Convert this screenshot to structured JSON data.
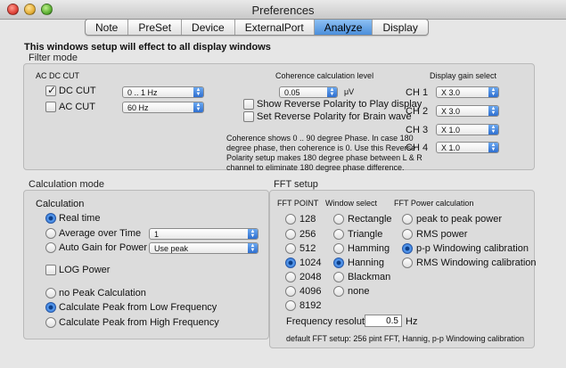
{
  "window": {
    "title": "Preferences"
  },
  "tabs": [
    "Note",
    "PreSet",
    "Device",
    "ExternalPort",
    "Analyze",
    "Display"
  ],
  "active_tab": "Analyze",
  "notice": "This windows setup will effect to all display windows",
  "filter_mode": {
    "label": "Filter mode",
    "ac_dc_cut": {
      "label": "AC DC CUT",
      "dc_cut": {
        "label": "DC CUT",
        "checked": true,
        "value": "0 .. 1 Hz"
      },
      "ac_cut": {
        "label": "AC CUT",
        "checked": false,
        "value": "60 Hz"
      }
    },
    "coherence": {
      "label": "Coherence calculation level",
      "value": "0.05",
      "unit": "μV",
      "show_reverse": "Show Reverse Polarity to Play display",
      "set_reverse": "Set Reverse Polarity for Brain wave",
      "info": "Coherence shows 0 .. 90 degree Phase. In case 180 degree phase, then coherence is 0. Use this Reverse Polarity setup makes 180 degree phase between L & R channel to eliminate 180 degree phase difference."
    },
    "display_gain": {
      "label": "Display gain select",
      "channels": [
        {
          "name": "CH 1",
          "value": "X 3.0"
        },
        {
          "name": "CH 2",
          "value": "X 3.0"
        },
        {
          "name": "CH 3",
          "value": "X 1.0"
        },
        {
          "name": "CH 4",
          "value": "X 1.0"
        }
      ]
    }
  },
  "calculation_mode": {
    "label": "Calculation mode",
    "calc_label": "Calculation",
    "real_time": "Real time",
    "average_over_time": "Average over Time",
    "average_value": "1",
    "auto_gain": "Auto Gain for Power",
    "auto_gain_value": "Use peak",
    "log_power": "LOG Power",
    "no_peak": "no Peak Calculation",
    "peak_low": "Calculate Peak from Low Frequency",
    "peak_high": "Calculate Peak from High Frequency"
  },
  "fft_setup": {
    "label": "FFT setup",
    "fft_point_label": "FFT POINT",
    "points": [
      "128",
      "256",
      "512",
      "1024",
      "2048",
      "4096",
      "8192"
    ],
    "selected_point": "1024",
    "window_label": "Window select",
    "windows": [
      "Rectangle",
      "Triangle",
      "Hamming",
      "Hanning",
      "Blackman",
      "none"
    ],
    "selected_window": "Hanning",
    "power_label": "FFT Power calculation",
    "power_options": [
      "peak to peak power",
      "RMS power",
      "p-p Windowing calibration",
      "RMS Windowing calibration"
    ],
    "selected_power": "p-p Windowing calibration",
    "freq_res_label": "Frequency resolution :",
    "freq_res_value": "0.5",
    "freq_res_unit": "Hz",
    "default_note": "default FFT setup: 256 pint FFT, Hannig, p-p Windowing calibration"
  }
}
